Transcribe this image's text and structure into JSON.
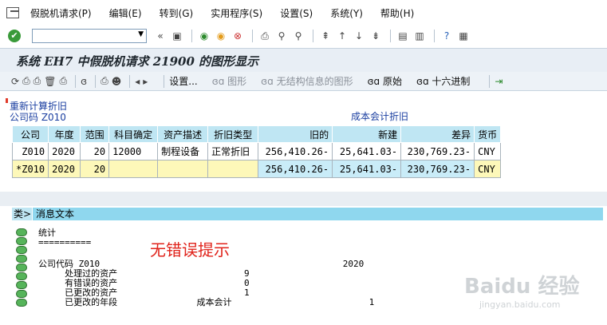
{
  "menu": [
    "假脱机请求(P)",
    "编辑(E)",
    "转到(G)",
    "实用程序(S)",
    "设置(S)",
    "系统(Y)",
    "帮助(H)"
  ],
  "command_field": {
    "value": ""
  },
  "window_title": "系统 EH7 中假脱机请求 21900 的图形显示",
  "app_toolbar": {
    "settings": "设置...",
    "graphic": "图形",
    "no_struct": "无结构信息的图形",
    "raw": "原始",
    "hex": "十六进制"
  },
  "report": {
    "heading": "重新计算折旧",
    "company_line": "公司码 Z010",
    "area_line": "成本会计折旧",
    "columns": [
      "公司",
      "年度",
      "范围",
      "科目确定",
      "资产描述",
      "折旧类型",
      "旧的",
      "新建",
      "差异",
      "货币"
    ],
    "rows": [
      [
        "Z010",
        "2020",
        "20",
        "12000",
        "制程设备",
        "正常折旧",
        "256,410.26-",
        "25,641.03-",
        "230,769.23-",
        "CNY"
      ],
      [
        "*Z010",
        "2020",
        "20",
        "",
        "",
        "",
        "256,410.26-",
        "25,641.03-",
        "230,769.23-",
        "CNY"
      ]
    ]
  },
  "messages": {
    "col_type": "类>",
    "col_text": "消息文本",
    "lines": [
      "统计",
      "==========",
      "",
      "",
      "公司代码 Z010                                              2020",
      "     处理过的资产                        9",
      "     有错误的资产                        0",
      "     已更改的资产                        1",
      "     已更改的年段               成本会计                          1"
    ],
    "annotation": "无错误提示"
  },
  "watermark": {
    "main": "Baidu 经验",
    "sub": "jingyan.baidu.com"
  },
  "colors": {
    "header_cyan": "#bfe6f3",
    "sum_yellow": "#fdf8b9",
    "status_green": "#56b45a",
    "note_red": "#e0231b"
  }
}
